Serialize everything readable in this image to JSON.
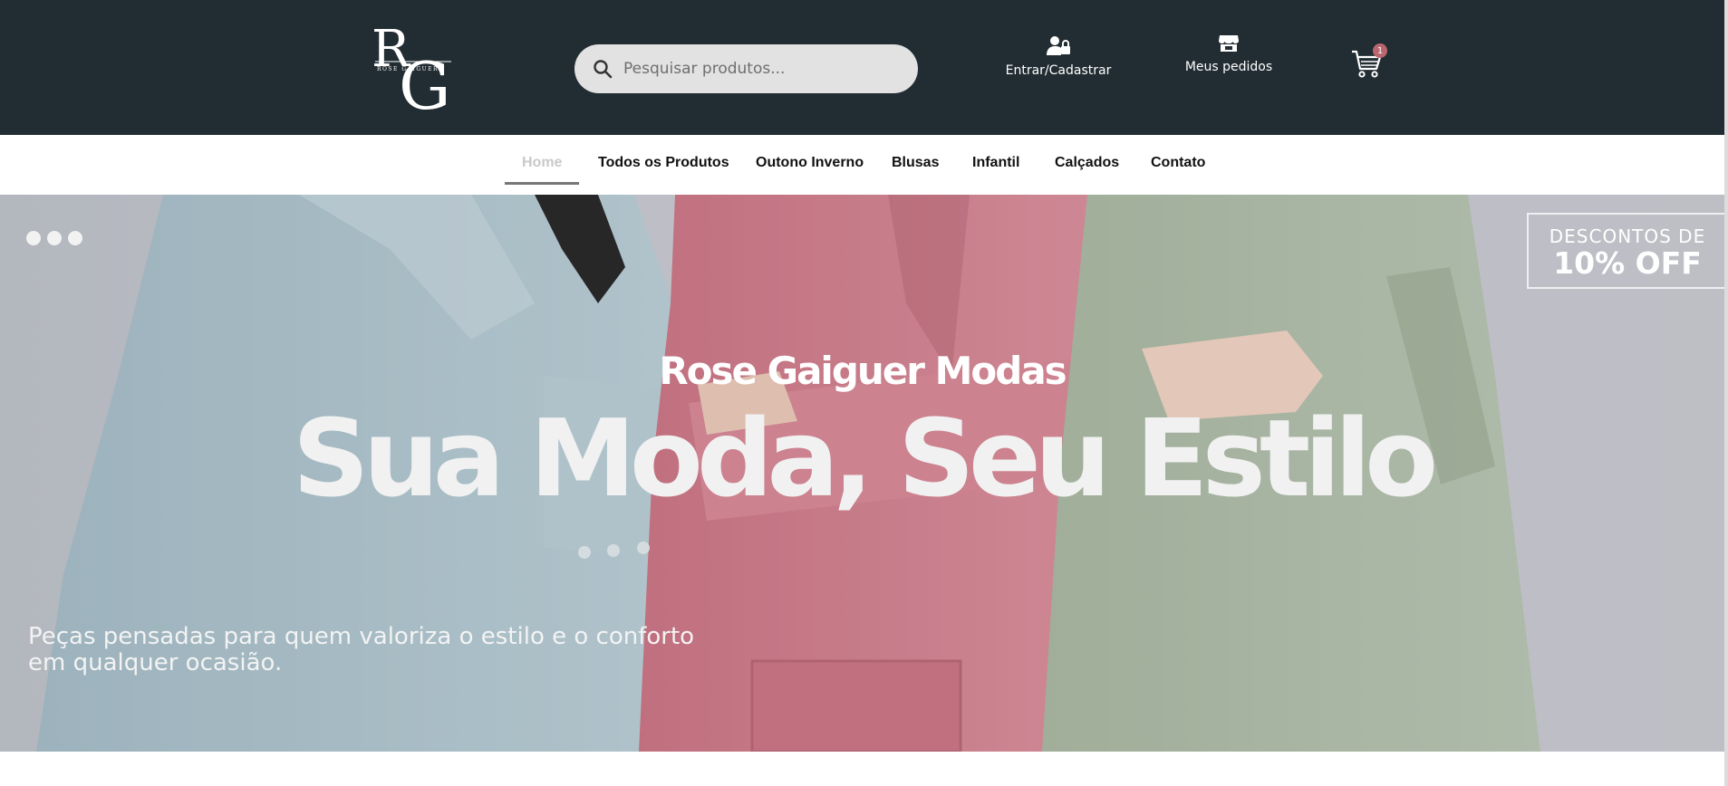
{
  "header": {
    "logo_letters": "RG",
    "logo_subtext": "ROSE GAIGUER",
    "search_placeholder": "Pesquisar produtos...",
    "login_label": "Entrar/Cadastrar",
    "orders_label": "Meus pedidos",
    "cart_count": "1"
  },
  "nav": {
    "items": [
      {
        "label": "Home",
        "active": true
      },
      {
        "label": "Todos os Produtos"
      },
      {
        "label": "Outono Inverno"
      },
      {
        "label": "Blusas"
      },
      {
        "label": "Infantil"
      },
      {
        "label": "Calçados"
      },
      {
        "label": "Contato"
      }
    ]
  },
  "hero": {
    "promo_line1": "DESCONTOS DE",
    "promo_line2": "10% OFF",
    "brand": "Rose Gaiguer Modas",
    "headline": "Sua Moda, Seu Estilo",
    "tagline_line1": "Peças pensadas para quem valoriza o estilo e o conforto",
    "tagline_line2": "em qualquer ocasião."
  },
  "colors": {
    "header_bg": "#222d33",
    "accent_badge": "#b9666f",
    "jacket_blue": "#a9c1cb",
    "jacket_pink": "#d27b8b",
    "jacket_green": "#aab9a2"
  }
}
